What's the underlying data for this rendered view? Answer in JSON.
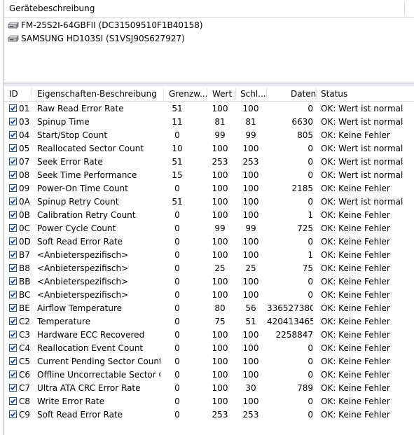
{
  "devices_panel": {
    "header": "Gerätebeschreibung",
    "devices": [
      {
        "label": "FM-25S2I-64GBFII (DC31509510F1B40158)",
        "icon": "hard-drive-icon"
      },
      {
        "label": "SAMSUNG HD103SI (S1VSJ90S627927)",
        "icon": "hard-drive-icon"
      }
    ]
  },
  "table": {
    "columns": {
      "id": "ID",
      "description": "Eigenschaften-Beschreibung",
      "threshold": "Grenzw...",
      "value": "Wert",
      "worst": "Schl...",
      "data": "Daten",
      "status": "Status"
    },
    "rows": [
      {
        "id": "01",
        "description": "Raw Read Error Rate",
        "threshold": "51",
        "value": "100",
        "worst": "100",
        "data": "0",
        "status": "OK: Wert ist normal"
      },
      {
        "id": "03",
        "description": "Spinup Time",
        "threshold": "11",
        "value": "81",
        "worst": "81",
        "data": "6630",
        "status": "OK: Wert ist normal"
      },
      {
        "id": "04",
        "description": "Start/Stop Count",
        "threshold": "0",
        "value": "99",
        "worst": "99",
        "data": "805",
        "status": "OK: Keine Fehler"
      },
      {
        "id": "05",
        "description": "Reallocated Sector Count",
        "threshold": "10",
        "value": "100",
        "worst": "100",
        "data": "0",
        "status": "OK: Wert ist normal"
      },
      {
        "id": "07",
        "description": "Seek Error Rate",
        "threshold": "51",
        "value": "253",
        "worst": "253",
        "data": "0",
        "status": "OK: Wert ist normal"
      },
      {
        "id": "08",
        "description": "Seek Time Performance",
        "threshold": "15",
        "value": "100",
        "worst": "100",
        "data": "0",
        "status": "OK: Wert ist normal"
      },
      {
        "id": "09",
        "description": "Power-On Time Count",
        "threshold": "0",
        "value": "100",
        "worst": "100",
        "data": "2185",
        "status": "OK: Keine Fehler"
      },
      {
        "id": "0A",
        "description": "Spinup Retry Count",
        "threshold": "51",
        "value": "100",
        "worst": "100",
        "data": "0",
        "status": "OK: Wert ist normal"
      },
      {
        "id": "0B",
        "description": "Calibration Retry Count",
        "threshold": "0",
        "value": "100",
        "worst": "100",
        "data": "1",
        "status": "OK: Keine Fehler"
      },
      {
        "id": "0C",
        "description": "Power Cycle Count",
        "threshold": "0",
        "value": "99",
        "worst": "99",
        "data": "725",
        "status": "OK: Keine Fehler"
      },
      {
        "id": "0D",
        "description": "Soft Read Error Rate",
        "threshold": "0",
        "value": "100",
        "worst": "100",
        "data": "0",
        "status": "OK: Keine Fehler"
      },
      {
        "id": "B7",
        "description": "<Anbieterspezifisch>",
        "threshold": "0",
        "value": "100",
        "worst": "100",
        "data": "1",
        "status": "OK: Keine Fehler"
      },
      {
        "id": "B8",
        "description": "<Anbieterspezifisch>",
        "threshold": "0",
        "value": "25",
        "worst": "25",
        "data": "75",
        "status": "OK: Keine Fehler"
      },
      {
        "id": "BB",
        "description": "<Anbieterspezifisch>",
        "threshold": "0",
        "value": "100",
        "worst": "100",
        "data": "0",
        "status": "OK: Keine Fehler"
      },
      {
        "id": "BC",
        "description": "<Anbieterspezifisch>",
        "threshold": "0",
        "value": "100",
        "worst": "100",
        "data": "0",
        "status": "OK: Keine Fehler"
      },
      {
        "id": "BE",
        "description": "Airflow Temperature",
        "threshold": "0",
        "value": "80",
        "worst": "56",
        "data": "336527380",
        "status": "OK: Keine Fehler"
      },
      {
        "id": "C2",
        "description": "Temperature",
        "threshold": "0",
        "value": "75",
        "worst": "51",
        "data": "420413465",
        "status": "OK: Keine Fehler"
      },
      {
        "id": "C3",
        "description": "Hardware ECC Recovered",
        "threshold": "0",
        "value": "100",
        "worst": "100",
        "data": "2258847",
        "status": "OK: Keine Fehler"
      },
      {
        "id": "C4",
        "description": "Reallocation Event Count",
        "threshold": "0",
        "value": "100",
        "worst": "100",
        "data": "0",
        "status": "OK: Keine Fehler"
      },
      {
        "id": "C5",
        "description": "Current Pending Sector Count",
        "threshold": "0",
        "value": "100",
        "worst": "100",
        "data": "0",
        "status": "OK: Keine Fehler"
      },
      {
        "id": "C6",
        "description": "Offline Uncorrectable Sector C...",
        "threshold": "0",
        "value": "100",
        "worst": "100",
        "data": "0",
        "status": "OK: Keine Fehler"
      },
      {
        "id": "C7",
        "description": "Ultra ATA CRC Error Rate",
        "threshold": "0",
        "value": "100",
        "worst": "30",
        "data": "789",
        "status": "OK: Keine Fehler"
      },
      {
        "id": "C8",
        "description": "Write Error Rate",
        "threshold": "0",
        "value": "100",
        "worst": "100",
        "data": "0",
        "status": "OK: Keine Fehler"
      },
      {
        "id": "C9",
        "description": "Soft Read Error Rate",
        "threshold": "0",
        "value": "253",
        "worst": "253",
        "data": "0",
        "status": "OK: Keine Fehler"
      }
    ]
  }
}
